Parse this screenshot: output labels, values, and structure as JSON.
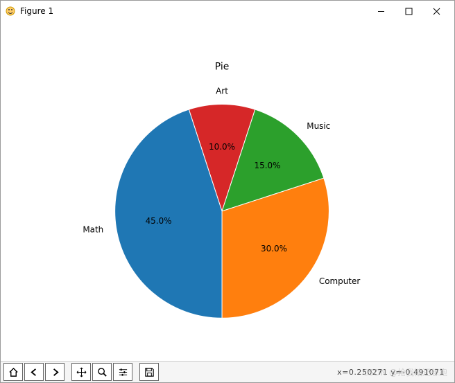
{
  "window": {
    "title": "Figure 1"
  },
  "toolbar": {
    "home": "home-icon",
    "back": "back-icon",
    "forward": "forward-icon",
    "pan": "pan-icon",
    "zoom": "zoom-icon",
    "config": "config-icon",
    "save": "save-icon"
  },
  "status": {
    "coords": "x=0.250271    y=-0.491071"
  },
  "watermark": "CSDN @抢我糖还想跑",
  "chart_data": {
    "type": "pie",
    "title": "Pie",
    "series": [
      {
        "name": "Art",
        "value": 10.0,
        "label": "10.0%",
        "color": "#d62728"
      },
      {
        "name": "Music",
        "value": 15.0,
        "label": "15.0%",
        "color": "#2ca02c"
      },
      {
        "name": "Computer",
        "value": 30.0,
        "label": "30.0%",
        "color": "#ff7f0e"
      },
      {
        "name": "Math",
        "value": 45.0,
        "label": "45.0%",
        "color": "#1f77b4"
      }
    ],
    "start_angle": 108
  }
}
